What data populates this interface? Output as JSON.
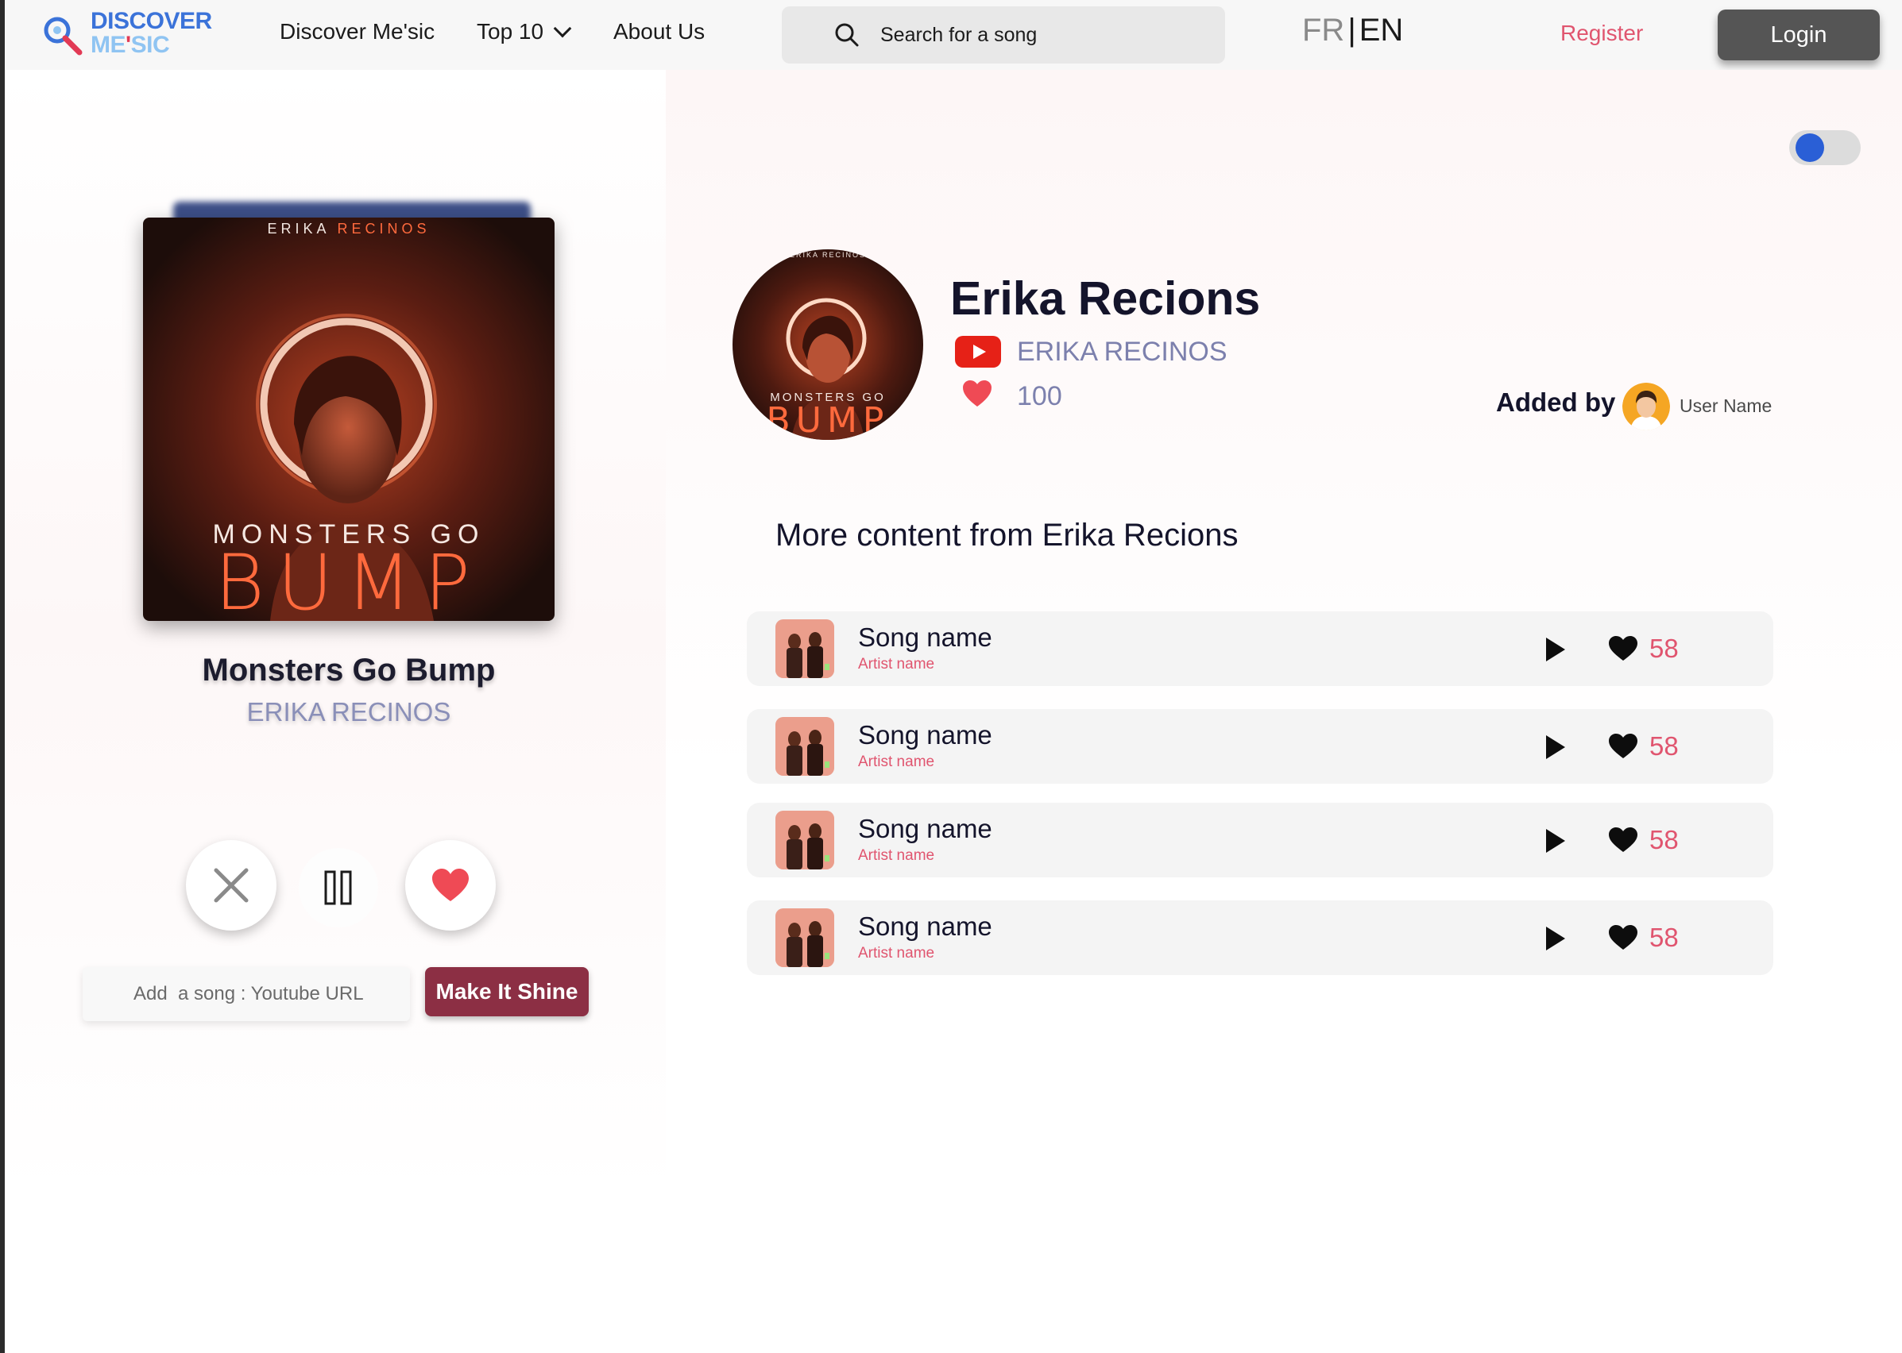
{
  "navbar": {
    "logo_line1": "DISCOVER",
    "logo_line2_a": "ME",
    "logo_line2_b": "'",
    "logo_line2_c": "SIC",
    "links": [
      {
        "label": "Discover Me'sic"
      },
      {
        "label": "Top 10"
      },
      {
        "label": "About Us"
      }
    ],
    "search_placeholder": "Search for a song",
    "lang_fr": "FR",
    "lang_sep": "|",
    "lang_en": "EN",
    "register_label": "Register",
    "login_label": "Login"
  },
  "player": {
    "cover_artist_first": "ERIKA",
    "cover_artist_last": "RECINOS",
    "cover_title_small": "MONSTERS GO",
    "cover_title_big": "BUMP",
    "title": "Monsters Go Bump",
    "artist": "ERIKA RECINOS",
    "url_placeholder": "Add  a song : Youtube URL",
    "submit_label": "Make It Shine"
  },
  "artist": {
    "name": "Erika Recions",
    "channel": "ERIKA RECINOS",
    "likes": "100",
    "added_by_label": "Added by",
    "added_by_user": "User Name",
    "avatar_top_text": "ERIKA RECINOS",
    "avatar_small_text": "MONSTERS GO",
    "avatar_big_text": "BUMP"
  },
  "more_content": {
    "title": "More content from Erika Recions",
    "songs": [
      {
        "name": "Song name",
        "artist": "Artist name",
        "likes": "58"
      },
      {
        "name": "Song name",
        "artist": "Artist name",
        "likes": "58"
      },
      {
        "name": "Song name",
        "artist": "Artist name",
        "likes": "58"
      },
      {
        "name": "Song name",
        "artist": "Artist name",
        "likes": "58"
      }
    ]
  },
  "colors": {
    "accent_pink": "#e0556f",
    "brand_blue": "#3b73d9",
    "button_maroon": "#8c2f44",
    "toggle_blue": "#2a5fd6",
    "heart_red": "#ef4a55"
  },
  "icons": [
    "search-icon",
    "chevron-down-icon",
    "youtube-icon",
    "heart-icon",
    "close-icon",
    "pause-icon",
    "play-icon"
  ]
}
